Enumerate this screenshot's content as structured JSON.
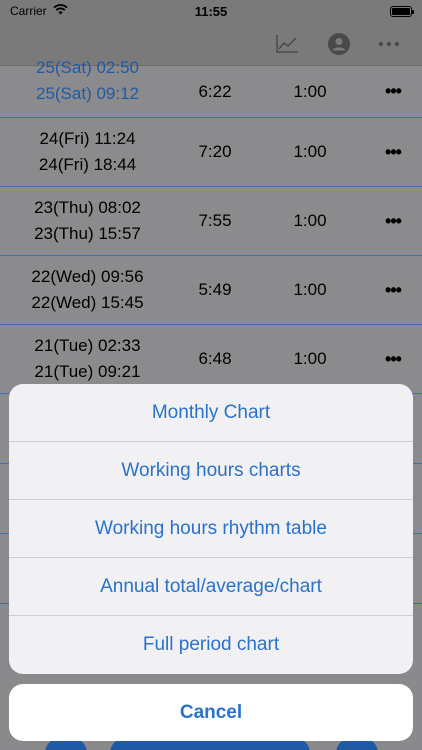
{
  "status": {
    "carrier": "Carrier",
    "time": "11:55"
  },
  "nav": {
    "icons": [
      "chart-line-icon",
      "person-circle-icon",
      "ellipsis-icon"
    ]
  },
  "rows": [
    {
      "start": "25(Sat) 02:50",
      "end": "25(Sat) 09:12",
      "duration": "6:22",
      "break": "1:00",
      "more": "•••"
    },
    {
      "start": "24(Fri) 11:24",
      "end": "24(Fri) 18:44",
      "duration": "7:20",
      "break": "1:00",
      "more": "•••"
    },
    {
      "start": "23(Thu) 08:02",
      "end": "23(Thu) 15:57",
      "duration": "7:55",
      "break": "1:00",
      "more": "•••"
    },
    {
      "start": "22(Wed) 09:56",
      "end": "22(Wed) 15:45",
      "duration": "5:49",
      "break": "1:00",
      "more": "•••"
    },
    {
      "start": "21(Tue) 02:33",
      "end": "21(Tue) 09:21",
      "duration": "6:48",
      "break": "1:00",
      "more": "•••"
    }
  ],
  "action_sheet": {
    "items": [
      "Monthly Chart",
      "Working hours charts",
      "Working hours rhythm table",
      "Annual total/average/chart",
      "Full period chart"
    ],
    "cancel": "Cancel"
  },
  "colors": {
    "accent": "#2a72c9",
    "dim_background": "#8a8a8c",
    "row_divider": "#3f6faf"
  }
}
